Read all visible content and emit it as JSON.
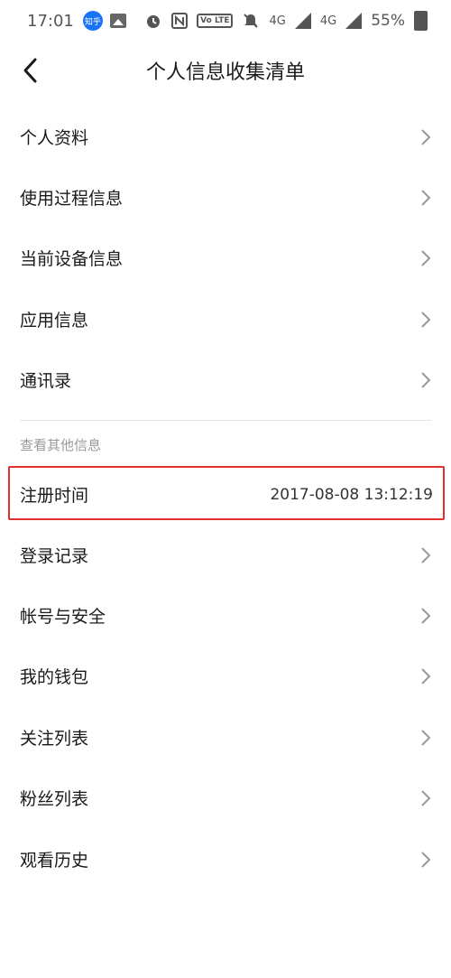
{
  "status_bar": {
    "time": "17:01",
    "app_badge": "知乎",
    "volte": "Vo LTE",
    "network_a": "4G",
    "network_b": "4G",
    "battery": "55%"
  },
  "header": {
    "title": "个人信息收集清单"
  },
  "list_top": [
    {
      "label": "个人资料"
    },
    {
      "label": "使用过程信息"
    },
    {
      "label": "当前设备信息"
    },
    {
      "label": "应用信息"
    },
    {
      "label": "通讯录"
    }
  ],
  "section": {
    "label": "查看其他信息"
  },
  "register": {
    "label": "注册时间",
    "value": "2017-08-08 13:12:19"
  },
  "list_bottom": [
    {
      "label": "登录记录"
    },
    {
      "label": "帐号与安全"
    },
    {
      "label": "我的钱包"
    },
    {
      "label": "关注列表"
    },
    {
      "label": "粉丝列表"
    },
    {
      "label": "观看历史"
    }
  ],
  "colors": {
    "highlight": "#e03030",
    "zhihu_blue": "#1772f6"
  }
}
